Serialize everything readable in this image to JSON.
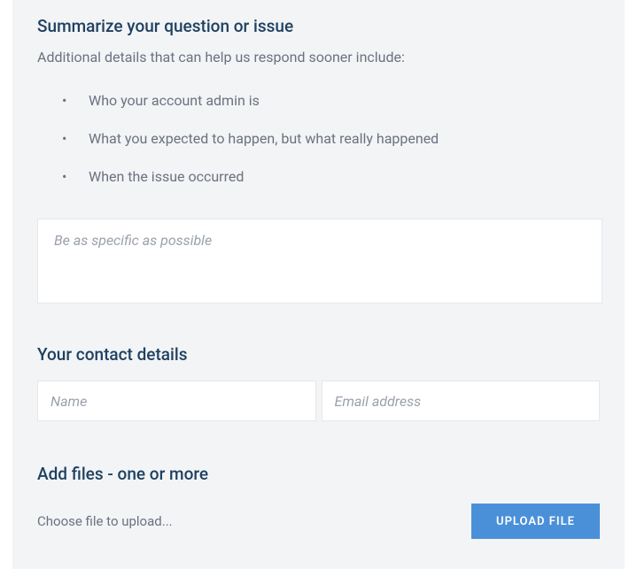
{
  "summarize": {
    "heading": "Summarize your question or issue",
    "subtext": "Additional details that can help us respond sooner include:",
    "bullets": [
      "Who your account admin is",
      "What you expected to happen, but what really happened",
      "When the issue occurred"
    ],
    "textarea_placeholder": "Be as specific as possible"
  },
  "contact": {
    "heading": "Your contact details",
    "name_placeholder": "Name",
    "email_placeholder": "Email address"
  },
  "files": {
    "heading": "Add files - one or more",
    "choose_label": "Choose file to upload...",
    "upload_button": "UPLOAD FILE"
  }
}
